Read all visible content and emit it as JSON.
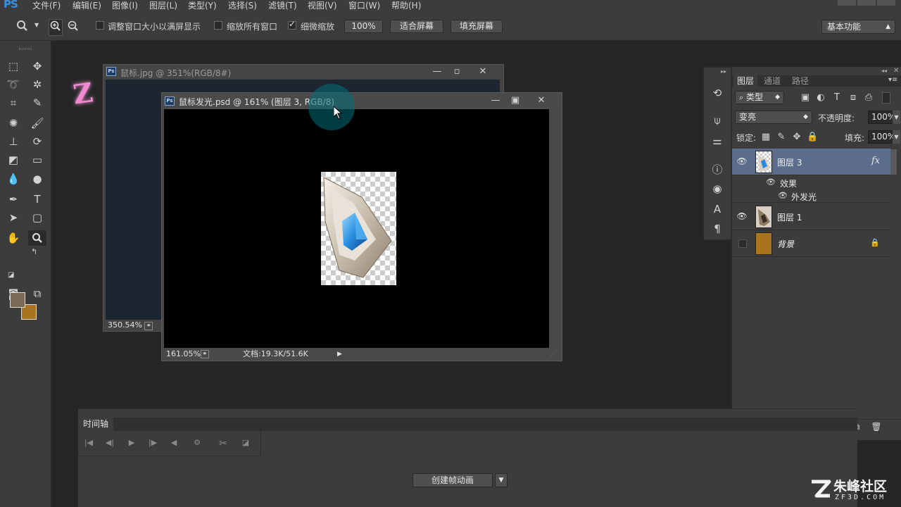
{
  "menubar": {
    "logo": "PS",
    "items": [
      "文件(F)",
      "编辑(E)",
      "图像(I)",
      "图层(L)",
      "类型(Y)",
      "选择(S)",
      "滤镜(T)",
      "视图(V)",
      "窗口(W)",
      "帮助(H)"
    ]
  },
  "options": {
    "zoom_tool_icon": "magnifier-icon",
    "resize_windows_label": "调整窗口大小以满屏显示",
    "resize_windows_checked": false,
    "zoom_all_windows_label": "缩放所有窗口",
    "zoom_all_windows_checked": false,
    "scrubby_zoom_label": "细微缩放",
    "scrubby_zoom_checked": true,
    "percent_button": "100%",
    "fit_screen_button": "适合屏幕",
    "fill_screen_button": "填充屏幕",
    "workspace": "基本功能"
  },
  "doc_back": {
    "title": "鼠标.jpg @ 351%(RGB/8#)",
    "zoom": "350.54%"
  },
  "doc_front": {
    "title": "鼠标发光.psd @ 161% (图层 3, RGB/8)",
    "zoom": "161.05%",
    "doc_info": "文档:19.3K/51.6K"
  },
  "layers_panel": {
    "tabs": [
      "图层",
      "通道",
      "路径"
    ],
    "active_tab": 0,
    "filter_kind": "类型",
    "blend_mode": "变亮",
    "opacity_label": "不透明度:",
    "opacity": "100%",
    "lock_label": "锁定:",
    "fill_label": "填充:",
    "fill": "100%",
    "layers": [
      {
        "name": "图层 3",
        "visible": true,
        "selected": true,
        "has_fx": true,
        "fx_label": "fx"
      },
      {
        "name": "图层 1",
        "visible": true,
        "selected": false,
        "has_fx": false
      },
      {
        "name": "背景",
        "visible": false,
        "selected": false,
        "locked": true
      }
    ],
    "effects_label": "效果",
    "effect_item": "外发光"
  },
  "timeline": {
    "tab": "时间轴",
    "create_button": "创建帧动画"
  },
  "watermark": {
    "brand": "朱峰社区",
    "url": "ZF3D.COM"
  },
  "colors": {
    "foreground": "#7a6a55",
    "background": "#a8741e",
    "selected_layer": "#5b6d8a",
    "bg_layer_fill": "#a8741e"
  }
}
